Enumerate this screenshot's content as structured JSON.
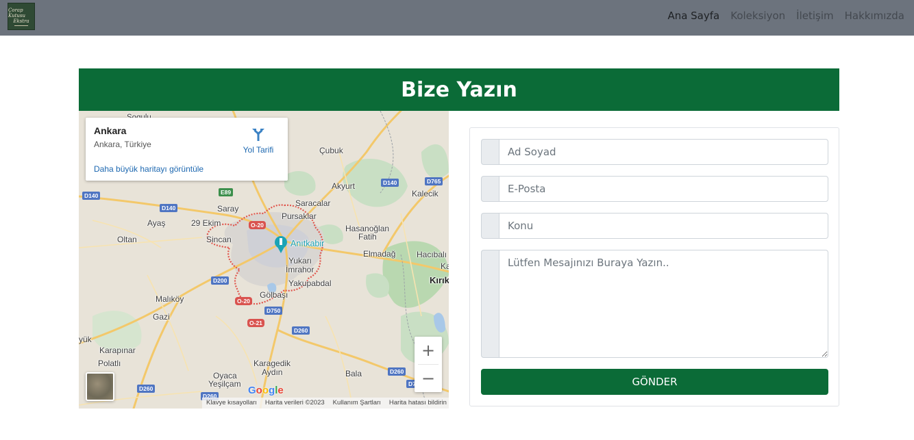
{
  "navbar": {
    "logo_text": [
      "Çorap Kutusu",
      "Ekstra"
    ],
    "links": [
      {
        "label": "Ana Sayfa",
        "active": true
      },
      {
        "label": "Koleksiyon",
        "active": false
      },
      {
        "label": "İletişim",
        "active": false
      },
      {
        "label": "Hakkımızda",
        "active": false
      }
    ],
    "background": "#6c737d"
  },
  "header": {
    "title": "Bize Yazın",
    "background": "#0b6b37"
  },
  "map": {
    "info_card": {
      "title": "Ankara",
      "subtitle": "Ankara, Türkiye",
      "directions_label": "Yol Tarifi",
      "larger_map_link": "Daha büyük haritayı görüntüle"
    },
    "labels": {
      "sogulu": "Sogulu",
      "cubuk": "Çubuk",
      "akyurt": "Akyurt",
      "kalecik": "Kalecik",
      "saray": "Saray",
      "saracalar": "Saracalar",
      "ayas": "Ayaş",
      "ekim29": "29 Ekim",
      "pursaklar": "Pursaklar",
      "hasanoglan": "Hasanoğlan",
      "fatih": "Fatih",
      "oltan": "Oltan",
      "sincan": "Sincan",
      "anitkabir": "Anıtkabir",
      "elmadag": "Elmadağ",
      "hacibali": "Hacıbalı",
      "ka": "Ka",
      "yukari": "Yukarı",
      "imrahor": "İmrahor",
      "kirik": "Kırık",
      "yakupabdal": "Yakupabdal",
      "malikoy": "Malıköy",
      "golbasi": "Gölbaşı",
      "gazi": "Gazi",
      "yuk": "yük",
      "karapinar": "Karapınar",
      "polatli": "Polatlı",
      "karagedik": "Karagedik",
      "aydin": "Aydın",
      "oyaca": "Oyaca",
      "yesilcam": "Yeşilçam",
      "bala": "Bala"
    },
    "road_badges": {
      "d140a": "D140",
      "d140b": "D140",
      "d140c": "D140",
      "d765": "D765",
      "e89": "E89",
      "o20a": "O-20",
      "o20b": "O-20",
      "o21": "O-21",
      "d200": "D200",
      "d750": "D750",
      "d260a": "D260",
      "d260b": "D260",
      "d260c": "D260",
      "d260d": "D260",
      "d7": "D7"
    },
    "zoom_in": "+",
    "zoom_out": "−",
    "google_logo": "Google",
    "attribution": [
      "Klavye kısayolları",
      "Harita verileri ©2023",
      "Kullanım Şartları",
      "Harita hatası bildirin"
    ]
  },
  "form": {
    "name_placeholder": "Ad Soyad",
    "email_placeholder": "E-Posta",
    "subject_placeholder": "Konu",
    "message_placeholder": "Lütfen Mesajınızı Buraya Yazın..",
    "submit_label": "GÖNDER",
    "accent": "#0b6b37"
  }
}
